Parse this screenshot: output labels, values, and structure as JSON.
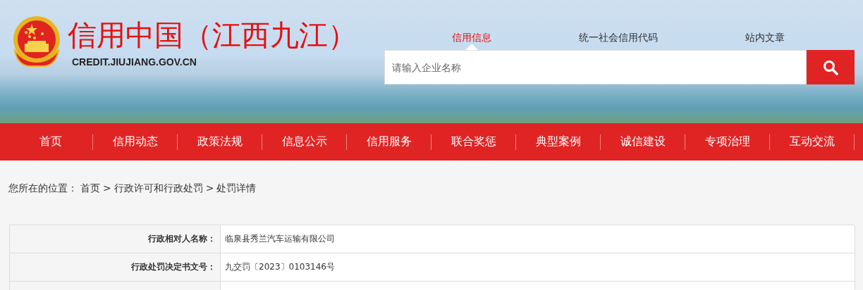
{
  "header": {
    "title": "信用中国（江西九江）",
    "url": "CREDIT.JIUJIANG.GOV.CN"
  },
  "search": {
    "tabs": [
      {
        "label": "信用信息",
        "selected": true
      },
      {
        "label": "统一社会信用代码",
        "selected": false
      },
      {
        "label": "站内文章",
        "selected": false
      }
    ],
    "placeholder": "请输入企业名称"
  },
  "nav": [
    "首页",
    "信用动态",
    "政策法规",
    "信息公示",
    "信用服务",
    "联合奖惩",
    "典型案例",
    "诚信建设",
    "专项治理",
    "互动交流"
  ],
  "breadcrumb": {
    "label": "您所在的位置：",
    "separator": ">",
    "items": [
      "首页",
      "行政许可和行政处罚",
      "处罚详情"
    ]
  },
  "table": {
    "rows": [
      {
        "label": "行政相对人名称：",
        "value": "临泉县秀兰汽车运输有限公司"
      },
      {
        "label": "行政处罚决定书文号：",
        "value": "九交罚〔2023〕0103146号"
      }
    ]
  }
}
